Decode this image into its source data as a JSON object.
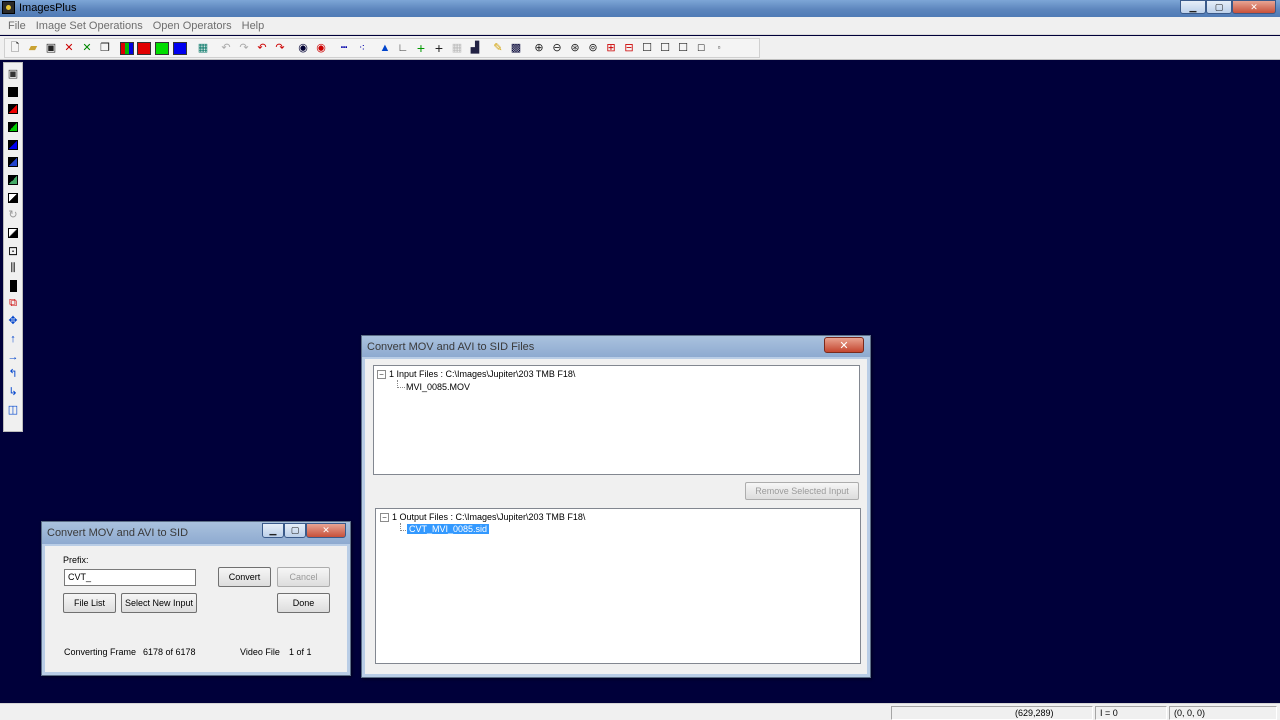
{
  "app": {
    "title": "ImagesPlus"
  },
  "menu": [
    "File",
    "Image Set Operations",
    "Open Operators",
    "Help"
  ],
  "toolbar": {
    "swatches": [
      "#cc0000",
      "#00d000",
      "#0000e0"
    ]
  },
  "convert_dialog": {
    "title": "Convert MOV and AVI to SID",
    "prefix_label": "Prefix:",
    "prefix_value": "CVT_",
    "convert_label": "Convert",
    "cancel_label": "Cancel",
    "file_list_label": "File List",
    "select_new_input_label": "Select New Input",
    "done_label": "Done",
    "converting_frame_label": "Converting Frame",
    "converting_frame_value": "6178 of 6178",
    "video_file_label": "Video File",
    "video_file_value": "1 of 1"
  },
  "files_dialog": {
    "title": "Convert MOV and AVI to SID Files",
    "input_root": "1 Input Files : C:\\Images\\Jupiter\\203 TMB F18\\",
    "input_file": "MVI_0085.MOV",
    "remove_label": "Remove Selected Input",
    "output_root": "1 Output Files : C:\\Images\\Jupiter\\203 TMB F18\\",
    "output_file": "CVT_MVI_0085.sid"
  },
  "status": {
    "coords": "(629,289)",
    "intensity": "I = 0",
    "rgb": "(0, 0, 0)"
  }
}
